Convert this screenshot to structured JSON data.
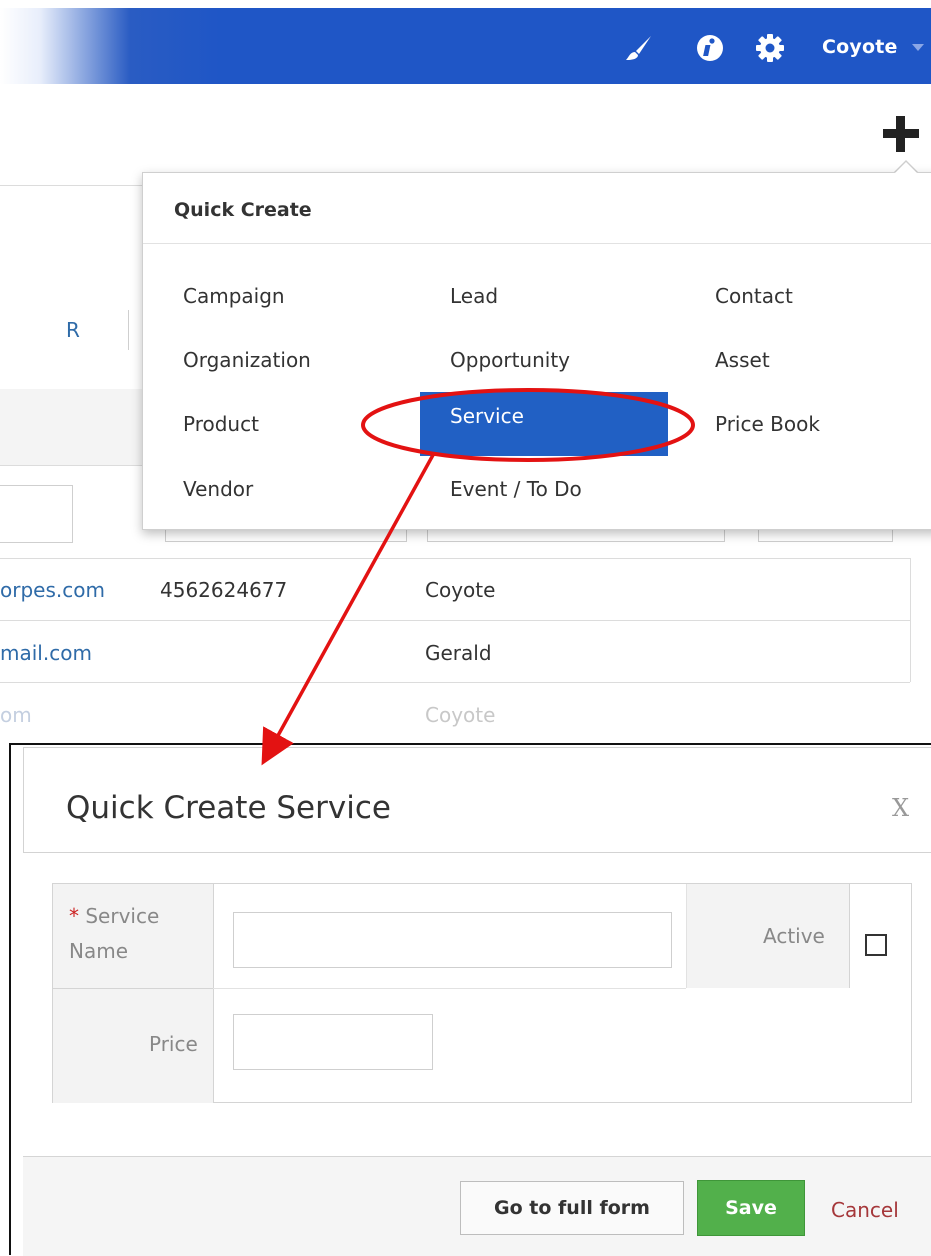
{
  "topbar": {
    "icons": [
      "paintbrush-icon",
      "info-icon",
      "gear-icon"
    ],
    "user": "Coyote"
  },
  "background": {
    "column_letter": "R",
    "rows": [
      {
        "email": "orpes.com",
        "phone": "4562624677",
        "owner": "Coyote"
      },
      {
        "email": "mail.com",
        "phone": "",
        "owner": "Gerald"
      },
      {
        "email": "om",
        "phone": "",
        "owner": "Coyote"
      }
    ]
  },
  "quick_create": {
    "title": "Quick Create",
    "items": [
      "Campaign",
      "Lead",
      "Contact",
      "Organization",
      "Opportunity",
      "Asset",
      "Product",
      "Service",
      "Price Book",
      "Vendor",
      "Event / To Do"
    ],
    "selected": "Service"
  },
  "modal": {
    "title": "Quick Create Service",
    "close": "X",
    "fields": {
      "service_name_required": "*",
      "service_name_label_1": "Service",
      "service_name_label_2": "Name",
      "service_name_value": "",
      "active_label": "Active",
      "active_checked": false,
      "price_label": "Price",
      "price_value": ""
    },
    "buttons": {
      "full_form": "Go to full form",
      "save": "Save",
      "cancel": "Cancel"
    }
  },
  "colors": {
    "topbar": "#1f56c6",
    "selected_item": "#2160c4",
    "save_button": "#52b04b",
    "cancel_link": "#a5373a",
    "annotation": "#e31212"
  }
}
